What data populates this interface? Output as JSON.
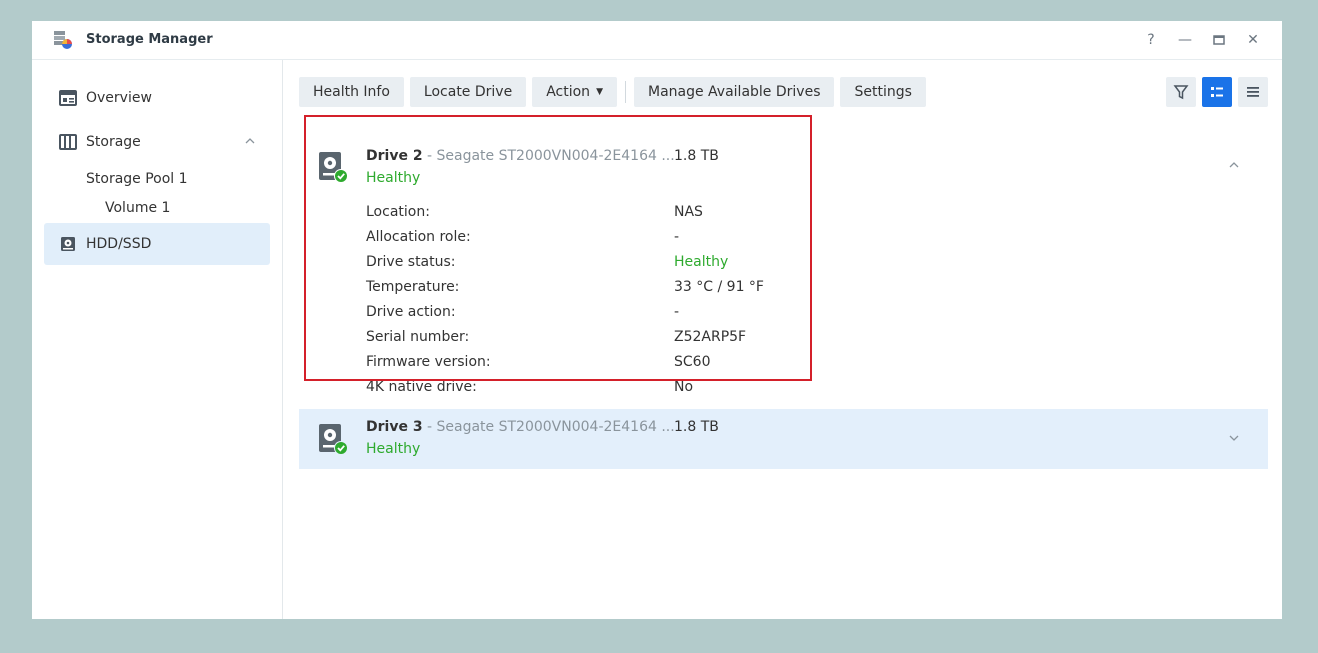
{
  "window": {
    "title": "Storage Manager",
    "controls": [
      "?",
      "—",
      "▭",
      "✕"
    ]
  },
  "sidebar": {
    "items": [
      {
        "label": "Overview",
        "icon": "overview-icon"
      },
      {
        "label": "Storage",
        "icon": "storage-icon"
      },
      {
        "label": "Storage Pool 1"
      },
      {
        "label": "Volume 1"
      },
      {
        "label": "HDD/SSD",
        "icon": "hdd-icon",
        "active": true
      }
    ]
  },
  "toolbar": {
    "health_info": "Health Info",
    "locate_drive": "Locate Drive",
    "action": "Action",
    "manage_drives": "Manage Available Drives",
    "settings": "Settings"
  },
  "drives": [
    {
      "name": "Drive 2",
      "model": " - Seagate ST2000VN004-2E4164 ...",
      "size": "1.8 TB",
      "health": "Healthy",
      "expanded": true,
      "details": [
        {
          "label": "Location:",
          "value": "NAS"
        },
        {
          "label": "Allocation role:",
          "value": "-"
        },
        {
          "label": "Drive status:",
          "value": "Healthy"
        },
        {
          "label": "Temperature:",
          "value": "33 °C / 91 °F"
        },
        {
          "label": "Drive action:",
          "value": "-"
        },
        {
          "label": "Serial number:",
          "value": "Z52ARP5F"
        },
        {
          "label": "Firmware version:",
          "value": "SC60"
        },
        {
          "label": "4K native drive:",
          "value": "No"
        }
      ]
    },
    {
      "name": "Drive 3",
      "model": " - Seagate ST2000VN004-2E4164 ...",
      "size": "1.8 TB",
      "health": "Healthy",
      "expanded": false
    }
  ],
  "colors": {
    "accent": "#1a73e8",
    "healthy": "#2eaa2e",
    "highlight": "#d4202a",
    "selected_bg": "#e3effb"
  }
}
